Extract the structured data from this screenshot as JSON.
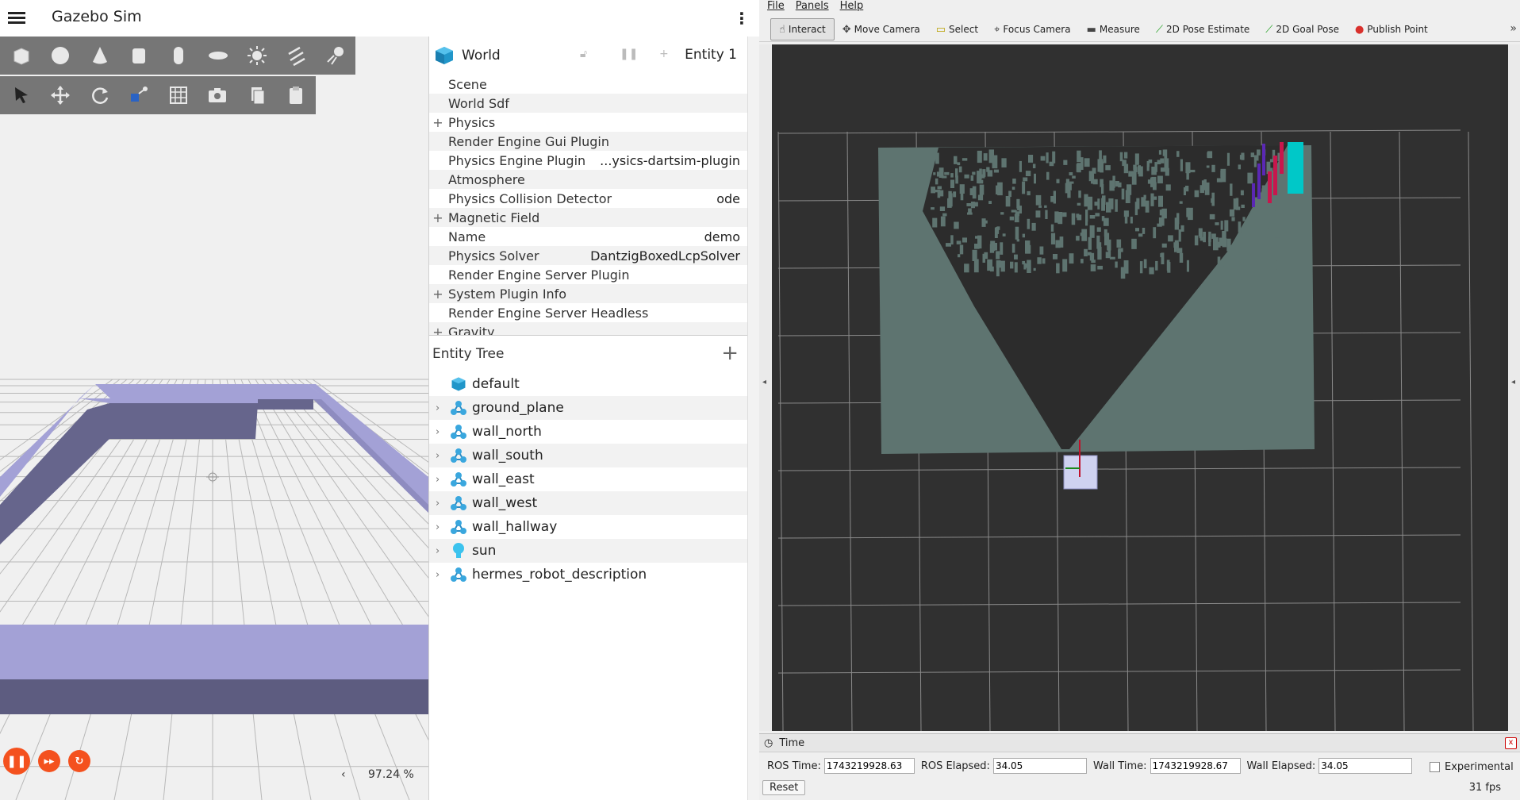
{
  "gazebo": {
    "title": "Gazebo Sim",
    "shape_tools": [
      "box",
      "sphere",
      "cone",
      "cylinder",
      "capsule",
      "ellipsoid",
      "sun-light",
      "directional-light",
      "spot-light"
    ],
    "transform_tools": [
      "select",
      "translate",
      "rotate",
      "transform-control",
      "grid",
      "screenshot",
      "copy",
      "paste"
    ],
    "rtf_arrow": "‹",
    "real_time_factor": "97.24 %",
    "component_inspector": {
      "world_label": "World",
      "entity_label": "Entity 1",
      "properties": [
        {
          "expand": "",
          "key": "Scene",
          "value": ""
        },
        {
          "expand": "",
          "key": "World Sdf",
          "value": ""
        },
        {
          "expand": "+",
          "key": "Physics",
          "value": ""
        },
        {
          "expand": "",
          "key": "Render Engine Gui Plugin",
          "value": ""
        },
        {
          "expand": "",
          "key": "Physics Engine Plugin",
          "value": "...ysics-dartsim-plugin"
        },
        {
          "expand": "",
          "key": "Atmosphere",
          "value": ""
        },
        {
          "expand": "",
          "key": "Physics Collision Detector",
          "value": "ode"
        },
        {
          "expand": "+",
          "key": "Magnetic Field",
          "value": ""
        },
        {
          "expand": "",
          "key": "Name",
          "value": "demo"
        },
        {
          "expand": "",
          "key": "Physics Solver",
          "value": "DantzigBoxedLcpSolver"
        },
        {
          "expand": "",
          "key": "Render Engine Server Plugin",
          "value": ""
        },
        {
          "expand": "+",
          "key": "System Plugin Info",
          "value": ""
        },
        {
          "expand": "",
          "key": "Render Engine Server Headless",
          "value": ""
        },
        {
          "expand": "+",
          "key": "Gravity",
          "value": ""
        }
      ]
    },
    "entity_tree": {
      "title": "Entity Tree",
      "add_label": "+",
      "items": [
        {
          "label": "default",
          "icon": "world-cube-icon",
          "expandable": false
        },
        {
          "label": "ground_plane",
          "icon": "model-icon",
          "expandable": true
        },
        {
          "label": "wall_north",
          "icon": "model-icon",
          "expandable": true
        },
        {
          "label": "wall_south",
          "icon": "model-icon",
          "expandable": true
        },
        {
          "label": "wall_east",
          "icon": "model-icon",
          "expandable": true
        },
        {
          "label": "wall_west",
          "icon": "model-icon",
          "expandable": true
        },
        {
          "label": "wall_hallway",
          "icon": "model-icon",
          "expandable": true
        },
        {
          "label": "sun",
          "icon": "light-bulb-icon",
          "expandable": true
        },
        {
          "label": "hermes_robot_description",
          "icon": "model-icon",
          "expandable": true
        }
      ]
    }
  },
  "rviz": {
    "menu": [
      "File",
      "Panels",
      "Help"
    ],
    "tools": [
      {
        "label": "Interact",
        "icon": "hand-icon",
        "active": true
      },
      {
        "label": "Move Camera",
        "icon": "move-camera-icon",
        "active": false
      },
      {
        "label": "Select",
        "icon": "select-box-icon",
        "active": false
      },
      {
        "label": "Focus Camera",
        "icon": "crosshair-icon",
        "active": false
      },
      {
        "label": "Measure",
        "icon": "ruler-icon",
        "active": false
      },
      {
        "label": "2D Pose Estimate",
        "icon": "green-arrow-icon",
        "active": false
      },
      {
        "label": "2D Goal Pose",
        "icon": "green-arrow-icon",
        "active": false
      },
      {
        "label": "Publish Point",
        "icon": "map-pin-icon",
        "active": false
      }
    ],
    "more": "»",
    "time_panel": {
      "title": "Time",
      "close": "x",
      "ros_time_label": "ROS Time:",
      "ros_time": "1743219928.63",
      "ros_elapsed_label": "ROS Elapsed:",
      "ros_elapsed": "34.05",
      "wall_time_label": "Wall Time:",
      "wall_time": "1743219928.67",
      "wall_elapsed_label": "Wall Elapsed:",
      "wall_elapsed": "34.05",
      "experimental_label": "Experimental",
      "reset_label": "Reset",
      "fps": "31 fps"
    }
  },
  "colors": {
    "gazebo_toolbar": "#767676",
    "gazebo_play_button": "#f4511e",
    "wall_top": "#a3a1d6",
    "wall_side": "#66658c",
    "rviz_background": "#303030",
    "costmap_free": "#5e7470",
    "costmap_inflation_cyan": "#00c8c8"
  }
}
